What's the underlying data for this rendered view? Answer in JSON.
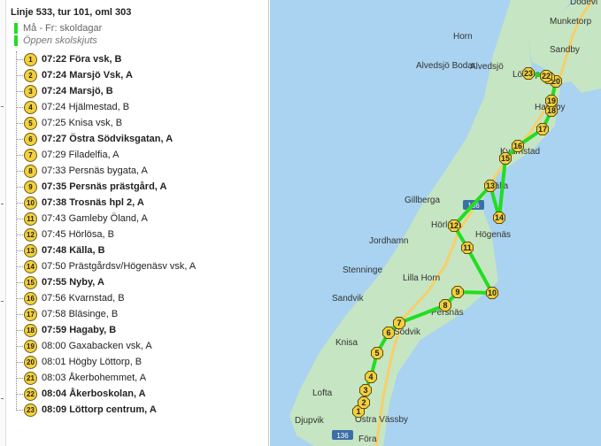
{
  "route": {
    "title": "Linje 533, tur 101, oml 303",
    "calendar": [
      {
        "text": "Må - Fr: skoldagar",
        "italic": false
      },
      {
        "text": "Öppen skolskjuts",
        "italic": true
      }
    ],
    "accent": "#22dd22"
  },
  "stops": [
    {
      "num": "1",
      "time": "07:22",
      "name": "Föra vsk, B",
      "bold": true
    },
    {
      "num": "2",
      "time": "07:24",
      "name": "Marsjö Vsk, A",
      "bold": true
    },
    {
      "num": "3",
      "time": "07:24",
      "name": "Marsjö, B",
      "bold": true
    },
    {
      "num": "4",
      "time": "07:24",
      "name": "Hjälmestad, B",
      "bold": false
    },
    {
      "num": "5",
      "time": "07:25",
      "name": "Knisa vsk, B",
      "bold": false
    },
    {
      "num": "6",
      "time": "07:27",
      "name": "Östra Södviksgatan, A",
      "bold": true
    },
    {
      "num": "7",
      "time": "07:29",
      "name": "Filadelfia, A",
      "bold": false
    },
    {
      "num": "8",
      "time": "07:33",
      "name": "Persnäs bygata, A",
      "bold": false
    },
    {
      "num": "9",
      "time": "07:35",
      "name": "Persnäs prästgård, A",
      "bold": true
    },
    {
      "num": "10",
      "time": "07:38",
      "name": "Trosnäs hpl 2, A",
      "bold": true
    },
    {
      "num": "11",
      "time": "07:43",
      "name": "Gamleby Öland, A",
      "bold": false
    },
    {
      "num": "12",
      "time": "07:45",
      "name": "Hörlösa, B",
      "bold": false
    },
    {
      "num": "13",
      "time": "07:48",
      "name": "Källa, B",
      "bold": true
    },
    {
      "num": "14",
      "time": "07:50",
      "name": "Prästgårdsv/Högenäsv vsk, A",
      "bold": false
    },
    {
      "num": "15",
      "time": "07:55",
      "name": "Nyby, A",
      "bold": true
    },
    {
      "num": "16",
      "time": "07:56",
      "name": "Kvarnstad, B",
      "bold": false
    },
    {
      "num": "17",
      "time": "07:58",
      "name": "Bläsinge, B",
      "bold": false
    },
    {
      "num": "18",
      "time": "07:59",
      "name": "Hagaby, B",
      "bold": true
    },
    {
      "num": "19",
      "time": "08:00",
      "name": "Gaxabacken vsk, A",
      "bold": false
    },
    {
      "num": "20",
      "time": "08:01",
      "name": "Högby Löttorp, B",
      "bold": false
    },
    {
      "num": "21",
      "time": "08:03",
      "name": "Åkerbohemmet, A",
      "bold": false
    },
    {
      "num": "22",
      "time": "08:04",
      "name": "Åkerboskolan, A",
      "bold": true
    },
    {
      "num": "23",
      "time": "08:09",
      "name": "Löttorp centrum, A",
      "bold": true
    }
  ],
  "map": {
    "place_labels": [
      "Dödevi",
      "Munketorp",
      "Sandby",
      "Horn",
      "Alvedsjö Bodar",
      "Alvedsjö",
      "Löttorp",
      "Hagaby",
      "Kvarnstad",
      "Källa",
      "Gillberga",
      "Hörlösa",
      "Högenäs",
      "Jordhamn",
      "Stenninge",
      "Lilla Horn",
      "Sandvik",
      "Persnäs",
      "Södvik",
      "Knisa",
      "Lofta",
      "Djupvik",
      "Östra Vässby",
      "Föra"
    ],
    "road_shields": [
      "136",
      "136"
    ],
    "colors": {
      "sea": "#a9d3f0",
      "land": "#c6e5c2",
      "route": "#22dd22",
      "road": "#f6cf6a"
    }
  }
}
